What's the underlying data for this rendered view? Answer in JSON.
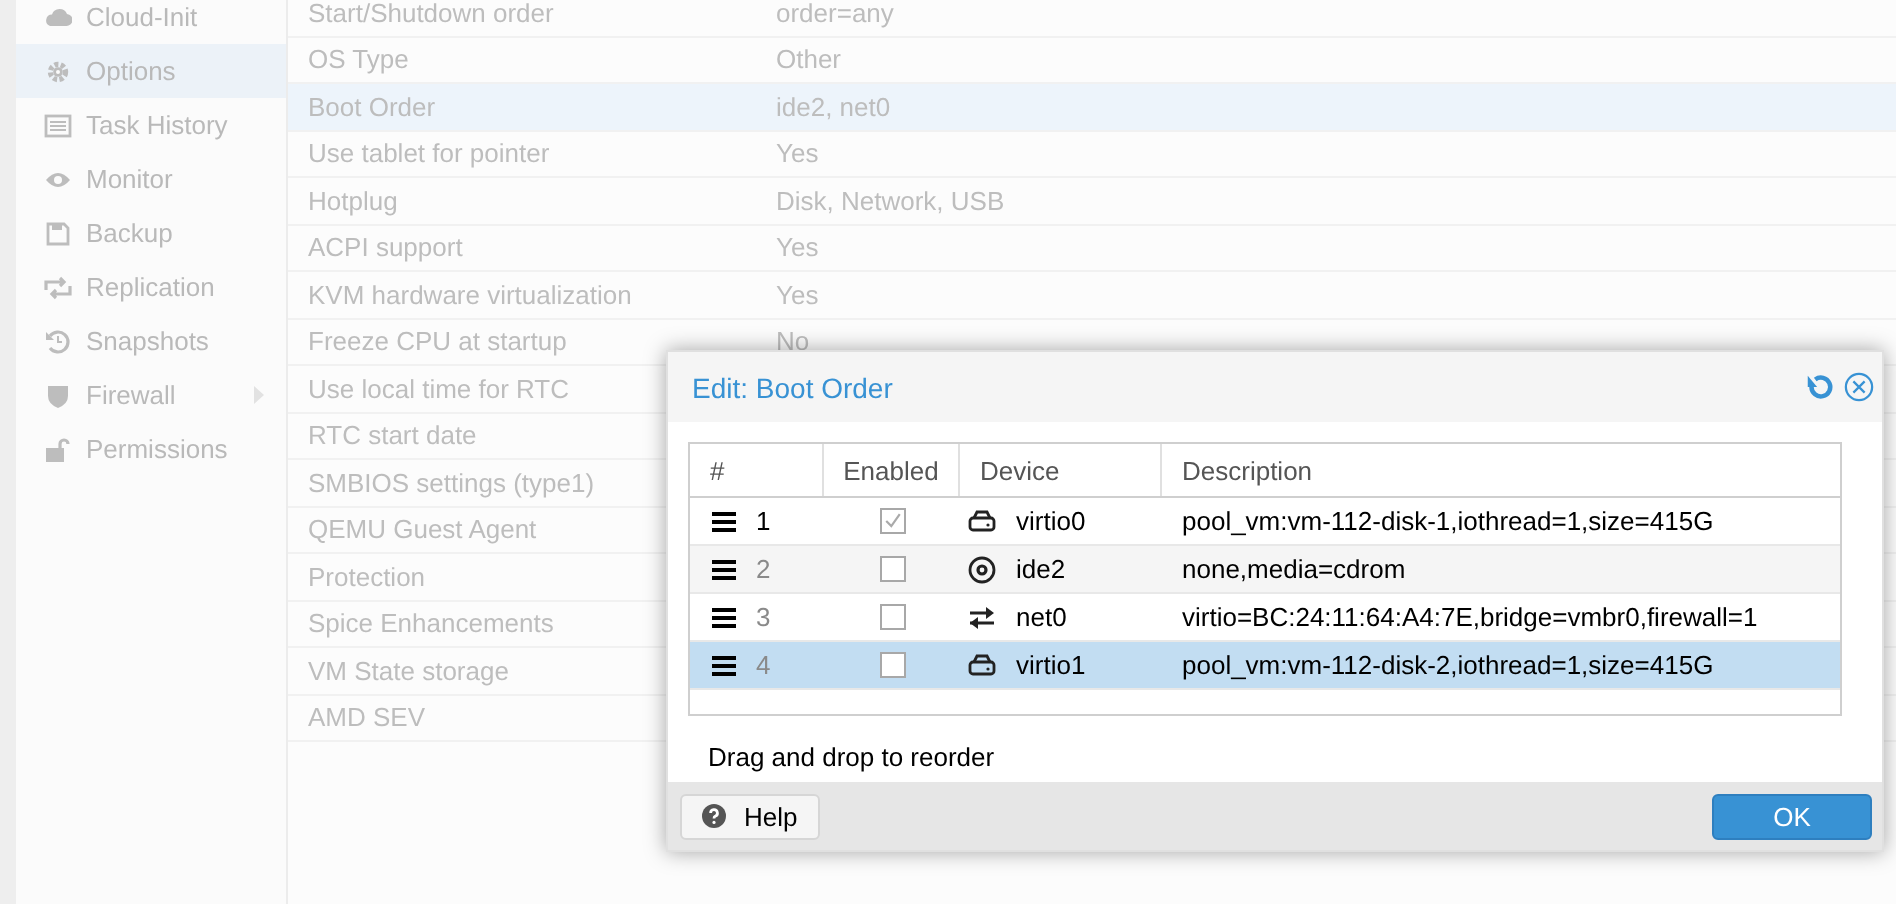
{
  "sidebar": {
    "items": [
      {
        "label": "Cloud-Init",
        "kind": "cloud",
        "selected": false,
        "has_submenu": false
      },
      {
        "label": "Options",
        "kind": "gear",
        "selected": true,
        "has_submenu": false
      },
      {
        "label": "Task History",
        "kind": "list",
        "selected": false,
        "has_submenu": false
      },
      {
        "label": "Monitor",
        "kind": "eye",
        "selected": false,
        "has_submenu": false
      },
      {
        "label": "Backup",
        "kind": "floppy",
        "selected": false,
        "has_submenu": false
      },
      {
        "label": "Replication",
        "kind": "sync",
        "selected": false,
        "has_submenu": false
      },
      {
        "label": "Snapshots",
        "kind": "history",
        "selected": false,
        "has_submenu": false
      },
      {
        "label": "Firewall",
        "kind": "shield",
        "selected": false,
        "has_submenu": true
      },
      {
        "label": "Permissions",
        "kind": "lock",
        "selected": false,
        "has_submenu": false
      }
    ]
  },
  "options": {
    "rows": [
      {
        "name": "Start/Shutdown order",
        "value": "order=any",
        "selected": false
      },
      {
        "name": "OS Type",
        "value": "Other",
        "selected": false
      },
      {
        "name": "Boot Order",
        "value": "ide2, net0",
        "selected": true
      },
      {
        "name": "Use tablet for pointer",
        "value": "Yes",
        "selected": false
      },
      {
        "name": "Hotplug",
        "value": "Disk, Network, USB",
        "selected": false
      },
      {
        "name": "ACPI support",
        "value": "Yes",
        "selected": false
      },
      {
        "name": "KVM hardware virtualization",
        "value": "Yes",
        "selected": false
      },
      {
        "name": "Freeze CPU at startup",
        "value": "No",
        "selected": false
      },
      {
        "name": "Use local time for RTC",
        "selected": false
      },
      {
        "name": "RTC start date",
        "selected": false
      },
      {
        "name": "SMBIOS settings (type1)",
        "selected": false
      },
      {
        "name": "QEMU Guest Agent",
        "selected": false
      },
      {
        "name": "Protection",
        "selected": false
      },
      {
        "name": "Spice Enhancements",
        "selected": false
      },
      {
        "name": "VM State storage",
        "selected": false
      },
      {
        "name": "AMD SEV",
        "selected": false
      }
    ]
  },
  "dialog": {
    "title": "Edit: Boot Order",
    "columns": [
      "#",
      "Enabled",
      "Device",
      "Description"
    ],
    "rows": [
      {
        "order": "1",
        "enabled": true,
        "kind": "disk",
        "device": "virtio0",
        "description": "pool_vm:vm-112-disk-1,iothread=1,size=415G",
        "selected": false
      },
      {
        "order": "2",
        "enabled": false,
        "kind": "cdrom",
        "device": "ide2",
        "description": "none,media=cdrom",
        "selected": false
      },
      {
        "order": "3",
        "enabled": false,
        "kind": "net",
        "device": "net0",
        "description": "virtio=BC:24:11:64:A4:7E,bridge=vmbr0,firewall=1",
        "selected": false
      },
      {
        "order": "4",
        "enabled": false,
        "kind": "disk",
        "device": "virtio1",
        "description": "pool_vm:vm-112-disk-2,iothread=1,size=415G",
        "selected": true
      }
    ],
    "hint": "Drag and drop to reorder",
    "help_button": "Help",
    "ok_button": "OK"
  }
}
